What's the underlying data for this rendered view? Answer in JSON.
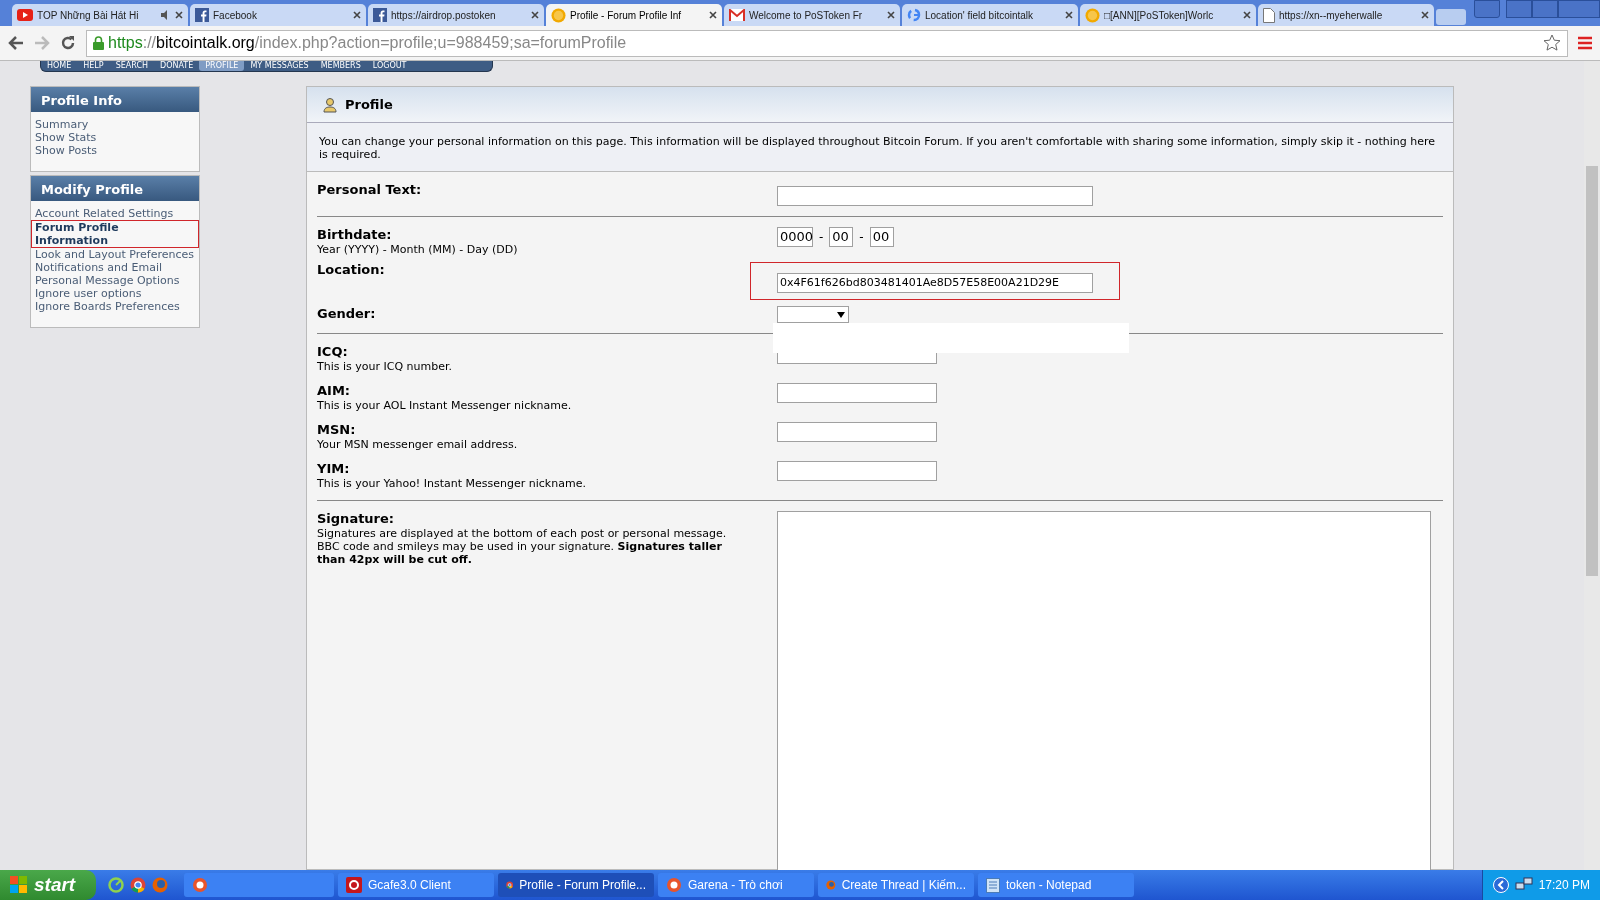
{
  "browser": {
    "tabs": [
      {
        "title": "TOP Những Bài Hát Hi",
        "kind": "youtube",
        "audio": true,
        "selected": false
      },
      {
        "title": "Facebook",
        "kind": "facebook",
        "audio": false,
        "selected": false
      },
      {
        "title": "https://airdrop.postoken",
        "kind": "facebook",
        "audio": false,
        "selected": false
      },
      {
        "title": "Profile - Forum Profile Inf",
        "kind": "bitcoin",
        "audio": false,
        "selected": true
      },
      {
        "title": "Welcome to PoSToken Fr",
        "kind": "gmail",
        "audio": false,
        "selected": false
      },
      {
        "title": "Location' field bitcointalk",
        "kind": "google",
        "audio": false,
        "selected": false
      },
      {
        "title": "□[ANN][PoSToken]Worlc",
        "kind": "bitcoin",
        "audio": false,
        "selected": false
      },
      {
        "title": "https://xn--myeherwalle",
        "kind": "page",
        "audio": false,
        "selected": false
      }
    ],
    "address": {
      "scheme": "https",
      "separator": "://",
      "host": "bitcointalk.org",
      "path": "/index.php?action=profile;u=988459;sa=forumProfile"
    }
  },
  "forum_menu": [
    {
      "label": "HOME",
      "selected": false
    },
    {
      "label": "HELP",
      "selected": false
    },
    {
      "label": "SEARCH",
      "selected": false
    },
    {
      "label": "DONATE",
      "selected": false
    },
    {
      "label": "PROFILE",
      "selected": true
    },
    {
      "label": "MY MESSAGES",
      "selected": false
    },
    {
      "label": "MEMBERS",
      "selected": false
    },
    {
      "label": "LOGOUT",
      "selected": false
    }
  ],
  "sidebar": [
    {
      "title": "Profile Info",
      "items": [
        {
          "label": "Summary",
          "selected": false,
          "highlighted": false
        },
        {
          "label": "Show Stats",
          "selected": false,
          "highlighted": false
        },
        {
          "label": "Show Posts",
          "selected": false,
          "highlighted": false
        }
      ]
    },
    {
      "title": "Modify Profile",
      "items": [
        {
          "label": "Account Related Settings",
          "selected": false,
          "highlighted": false
        },
        {
          "label": "Forum Profile Information",
          "selected": true,
          "highlighted": true
        },
        {
          "label": "Look and Layout Preferences",
          "selected": false,
          "highlighted": false
        },
        {
          "label": "Notifications and Email",
          "selected": false,
          "highlighted": false
        },
        {
          "label": "Personal Message Options",
          "selected": false,
          "highlighted": false
        },
        {
          "label": "Ignore user options",
          "selected": false,
          "highlighted": false
        },
        {
          "label": "Ignore Boards Preferences",
          "selected": false,
          "highlighted": false
        }
      ]
    }
  ],
  "panel": {
    "title": "Profile",
    "description": "You can change your personal information on this page. This information will be displayed throughout Bitcoin Forum. If you aren't comfortable with sharing some information, simply skip it - nothing here is required.",
    "sections": [
      [
        {
          "kind": "long_text",
          "label": "Personal Text:"
        }
      ],
      [
        {
          "kind": "date",
          "label": "Birthdate:",
          "hint": "Year (YYYY) - Month (MM) - Day (DD)",
          "year": "0000",
          "month": "00",
          "day": "00",
          "separators": [
            "-",
            "-"
          ]
        },
        {
          "kind": "long_text",
          "label": "Location:",
          "value": "0x4F61f626bd803481401Ae8D57E58E00A21D29E",
          "highlighted": true
        },
        {
          "kind": "select",
          "label": "Gender:",
          "expanded": true
        }
      ],
      [
        {
          "kind": "short_text",
          "label": "ICQ:",
          "hint": "This is your ICQ number."
        },
        {
          "kind": "short_text",
          "label": "AIM:",
          "hint": "This is your AOL Instant Messenger nickname."
        },
        {
          "kind": "short_text",
          "label": "MSN:",
          "hint": "Your MSN messenger email address."
        },
        {
          "kind": "short_text",
          "label": "YIM:",
          "hint": "This is your Yahoo! Instant Messenger nickname."
        }
      ],
      [
        {
          "kind": "textarea",
          "label": "Signature:",
          "hint": "Signatures are displayed at the bottom of each post or personal message. BBC code and smileys may be used in your signature. **Signatures taller than 42px will be cut off.**"
        }
      ]
    ]
  },
  "taskbar": {
    "start": "start",
    "quick_launch": [
      {
        "kind": "ring"
      },
      {
        "kind": "chrome"
      },
      {
        "kind": "firefox"
      }
    ],
    "tasks": [
      {
        "kind": "garena",
        "selected": false
      },
      {
        "title": "Gcafe3.0 Client",
        "kind": "gcafe",
        "selected": false
      },
      {
        "title": "Profile - Forum Profile...",
        "kind": "chrome",
        "selected": true
      },
      {
        "title": "Garena - Trò chơi",
        "kind": "garena",
        "selected": false
      },
      {
        "title": "Create Thread | Kiếm...",
        "kind": "firefox",
        "selected": false
      },
      {
        "title": "token - Notepad",
        "kind": "notepad",
        "selected": false
      }
    ],
    "clock": "17:20 PM"
  }
}
